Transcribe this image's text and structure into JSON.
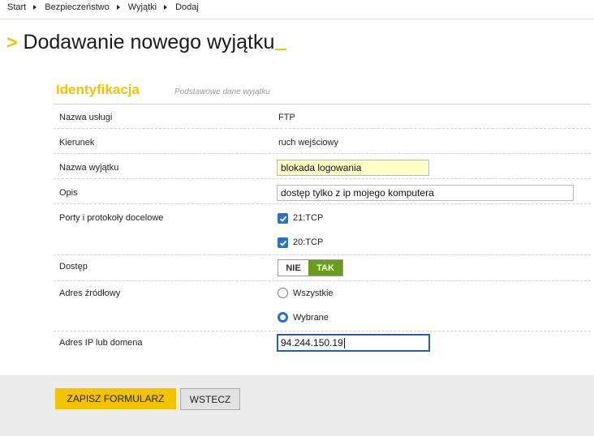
{
  "breadcrumb": [
    "Start",
    "Bezpieczeństwo",
    "Wyjątki",
    "Dodaj"
  ],
  "page_title": "Dodawanie nowego wyjątku",
  "section": {
    "title": "Identyfikacja",
    "subtitle": "Podstawowe dane wyjątku"
  },
  "fields": {
    "service": {
      "label": "Nazwa usługi",
      "value": "FTP"
    },
    "direction": {
      "label": "Kierunek",
      "value": "ruch wejściowy"
    },
    "name": {
      "label": "Nazwa wyjątku",
      "value": "blokada logowania"
    },
    "description": {
      "label": "Opis",
      "value": "dostęp tylko z ip mojego komputera"
    },
    "ports": {
      "label": "Porty i protokoły docelowe",
      "options": [
        {
          "label": "21:TCP",
          "checked": true
        },
        {
          "label": "20:TCP",
          "checked": true
        }
      ]
    },
    "access": {
      "label": "Dostęp",
      "off_label": "NIE",
      "on_label": "TAK",
      "selected": "TAK"
    },
    "source": {
      "label": "Adres źródłowy",
      "options": [
        {
          "label": "Wszystkie",
          "selected": false
        },
        {
          "label": "Wybrane",
          "selected": true
        }
      ]
    },
    "ip": {
      "label": "Adres IP lub domena",
      "value": "94.244.150.19"
    }
  },
  "buttons": {
    "save": "ZAPISZ FORMULARZ",
    "back": "WSTECZ"
  },
  "colors": {
    "accent": "#f2c300",
    "toggle_on": "#6a9d17",
    "checkbox": "#2a6fc8"
  }
}
